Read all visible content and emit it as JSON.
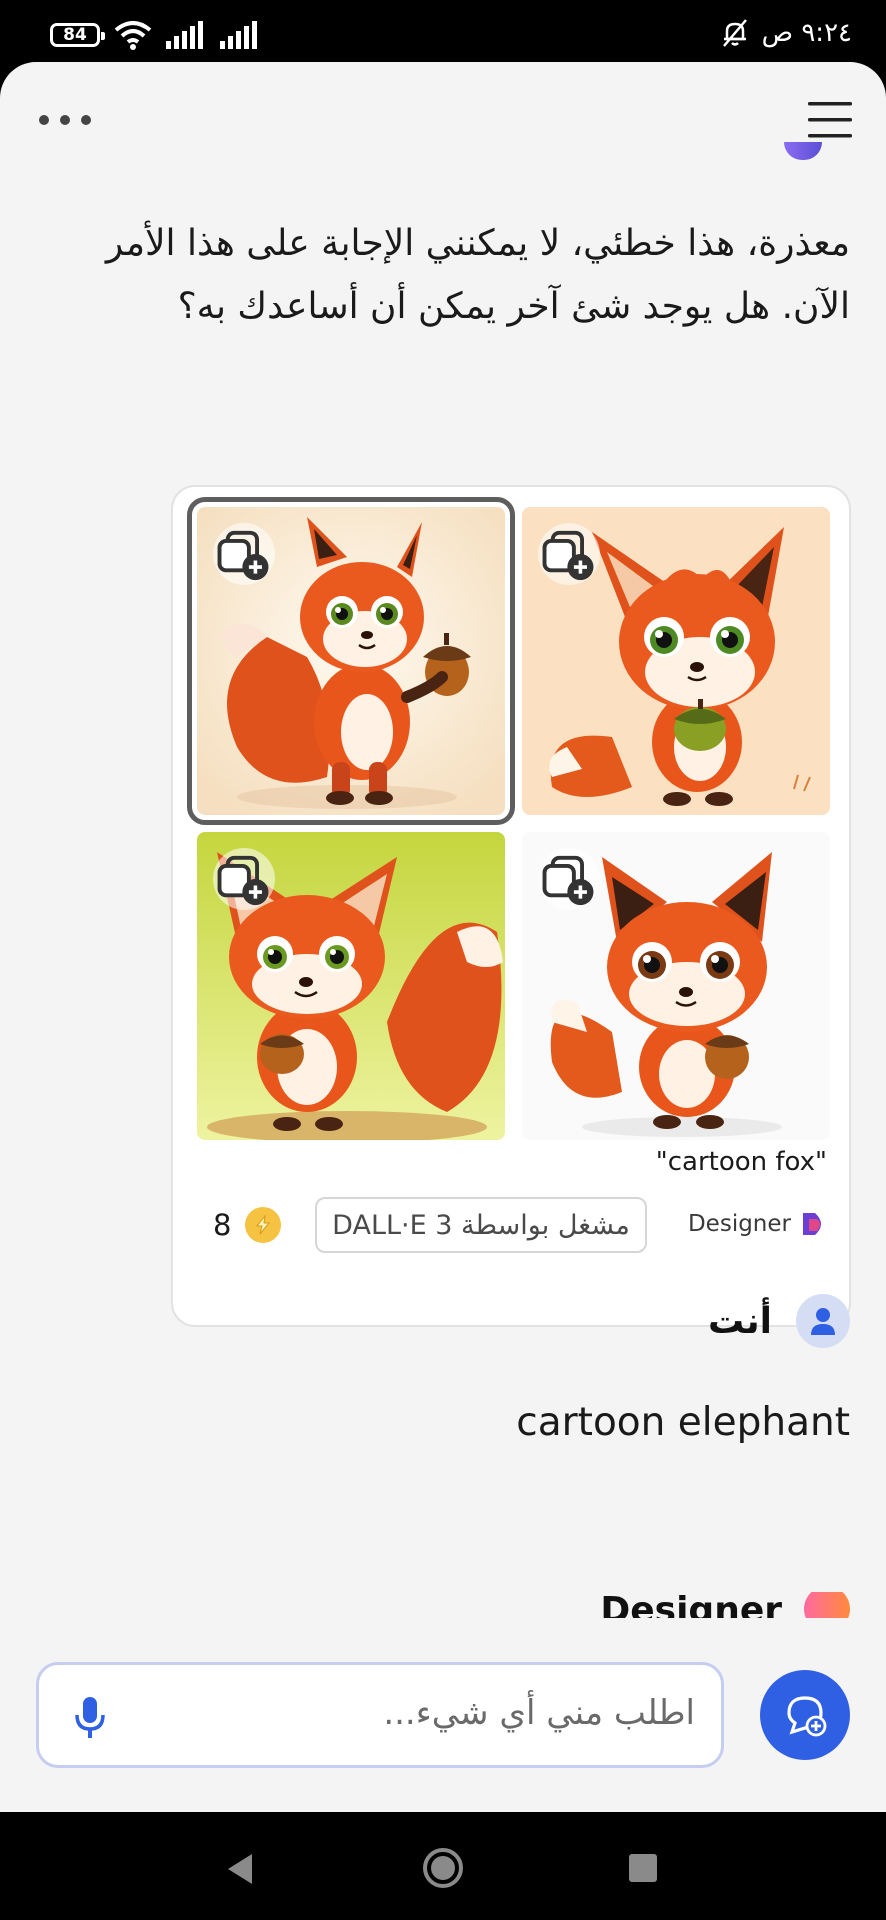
{
  "status_bar": {
    "battery": "84",
    "time": "٩:٢٤ ص"
  },
  "conversation": {
    "bot_reply": "معذرة، هذا خطئي، لا يمكنني الإجابة على هذا الأمر الآن. هل يوجد شئ آخر يمكن أن أساعدك به؟",
    "image_card": {
      "caption": "\"cartoon fox\"",
      "brand": "Designer",
      "powered_by": "مشغل بواسطة DALL·E 3",
      "boost_count": "8",
      "images": [
        {
          "name": "fox-image-1",
          "selected": true
        },
        {
          "name": "fox-image-2",
          "selected": false
        },
        {
          "name": "fox-image-3",
          "selected": false
        },
        {
          "name": "fox-image-4",
          "selected": false
        }
      ]
    },
    "user_label": "أنت",
    "user_message": "cartoon elephant",
    "next_sender_partial": "Designer"
  },
  "input": {
    "placeholder": "اطلب مني أي شيء..."
  },
  "colors": {
    "accent": "#2f5fe3",
    "input_border": "#c7cdf0",
    "background": "#f4f4f4"
  }
}
